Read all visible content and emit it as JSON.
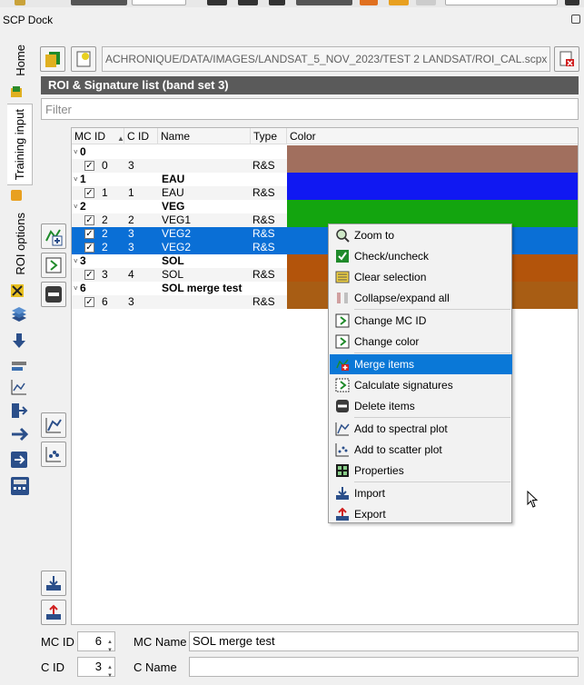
{
  "dock": {
    "title": "SCP Dock"
  },
  "tabs": [
    {
      "label": "Home"
    },
    {
      "label": "Training input"
    },
    {
      "label": "ROI options"
    }
  ],
  "toolbar": {
    "path": "ACHRONIQUE/DATA/IMAGES/LANDSAT_5_NOV_2023/TEST 2 LANDSAT/ROI_CAL.scpx"
  },
  "section": {
    "title": "ROI & Signature list (band set 3)"
  },
  "filter": {
    "placeholder": "Filter",
    "value": ""
  },
  "table": {
    "headers": [
      "MC ID",
      "C ID",
      "Name",
      "Type",
      "Color"
    ],
    "rows": [
      {
        "kind": "group",
        "mc": "0",
        "cid": "",
        "name": "",
        "type": "",
        "color": "#a16f5e",
        "checked": false,
        "selected": false
      },
      {
        "kind": "item",
        "mc": "0",
        "cid": "3",
        "name": "",
        "type": "R&S",
        "color": "#a16f5e",
        "checked": true,
        "selected": false
      },
      {
        "kind": "group",
        "mc": "1",
        "cid": "",
        "name": "EAU",
        "type": "",
        "color": "#1018f2",
        "checked": false,
        "selected": false
      },
      {
        "kind": "item",
        "mc": "1",
        "cid": "1",
        "name": "EAU",
        "type": "R&S",
        "color": "#1018f2",
        "checked": true,
        "selected": false
      },
      {
        "kind": "group",
        "mc": "2",
        "cid": "",
        "name": "VEG",
        "type": "",
        "color": "#13a50f",
        "checked": false,
        "selected": false
      },
      {
        "kind": "item",
        "mc": "2",
        "cid": "2",
        "name": "VEG1",
        "type": "R&S",
        "color": "#13a50f",
        "checked": true,
        "selected": false
      },
      {
        "kind": "item",
        "mc": "2",
        "cid": "3",
        "name": "VEG2",
        "type": "R&S",
        "color": "#0a6fd6",
        "checked": true,
        "selected": true
      },
      {
        "kind": "item",
        "mc": "2",
        "cid": "3",
        "name": "VEG2",
        "type": "R&S",
        "color": "#0a6fd6",
        "checked": true,
        "selected": true
      },
      {
        "kind": "group",
        "mc": "3",
        "cid": "",
        "name": "SOL",
        "type": "",
        "color": "#b3540b",
        "checked": false,
        "selected": false
      },
      {
        "kind": "item",
        "mc": "3",
        "cid": "4",
        "name": "SOL",
        "type": "R&S",
        "color": "#b3540b",
        "checked": true,
        "selected": false
      },
      {
        "kind": "group",
        "mc": "6",
        "cid": "",
        "name": "SOL merge test",
        "type": "",
        "color": "#a85d14",
        "checked": false,
        "selected": false
      },
      {
        "kind": "item",
        "mc": "6",
        "cid": "3",
        "name": "",
        "type": "R&S",
        "color": "#a85d14",
        "checked": true,
        "selected": false
      }
    ]
  },
  "context_menu": {
    "items": [
      {
        "label": "Zoom to",
        "icon": "zoom-icon"
      },
      {
        "label": "Check/uncheck",
        "icon": "check-icon"
      },
      {
        "label": "Clear selection",
        "icon": "clear-selection-icon"
      },
      {
        "label": "Collapse/expand all",
        "icon": "collapse-icon"
      },
      {
        "label": "Change MC ID",
        "icon": "change-id-icon"
      },
      {
        "label": "Change color",
        "icon": "change-color-icon"
      },
      {
        "label": "Merge items",
        "icon": "merge-icon"
      },
      {
        "label": "Calculate signatures",
        "icon": "calculate-icon"
      },
      {
        "label": "Delete items",
        "icon": "delete-icon"
      },
      {
        "label": "Add to spectral plot",
        "icon": "spectral-plot-icon"
      },
      {
        "label": "Add to scatter plot",
        "icon": "scatter-plot-icon"
      },
      {
        "label": "Properties",
        "icon": "properties-icon"
      },
      {
        "label": "Import",
        "icon": "import-icon"
      },
      {
        "label": "Export",
        "icon": "export-icon"
      }
    ],
    "highlighted": "Merge items"
  },
  "form": {
    "mc_id_label": "MC ID",
    "mc_id_value": "6",
    "mc_name_label": "MC Name",
    "mc_name_value": "SOL merge test",
    "c_id_label": "C ID",
    "c_id_value": "3",
    "c_name_label": "C Name",
    "c_name_value": ""
  }
}
